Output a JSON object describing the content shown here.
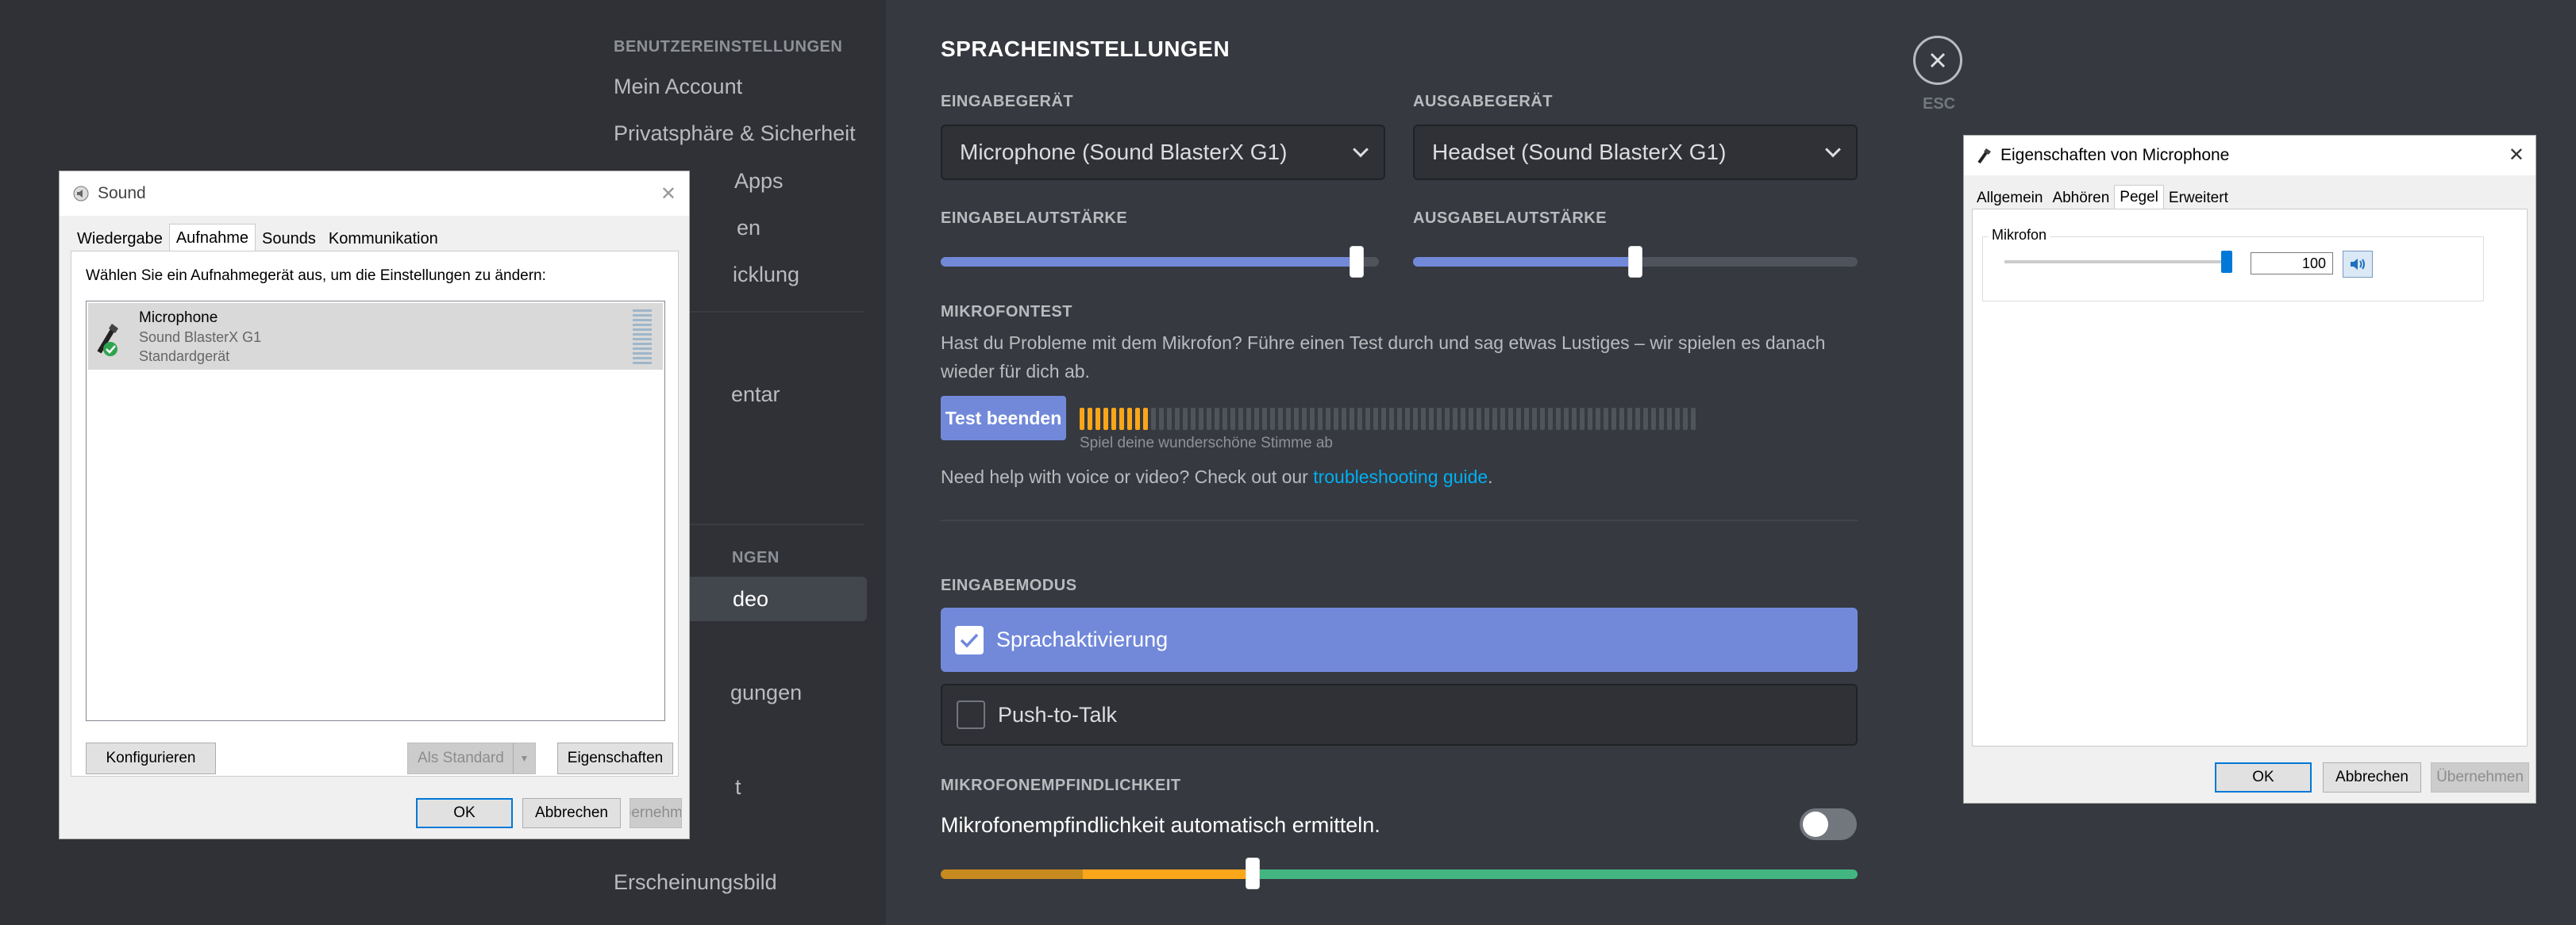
{
  "sidebar": {
    "section_user": "BENUTZEREINSTELLUNGEN",
    "items_user": [
      "Mein Account",
      "Privatsphäre & Sicherheit",
      "Apps",
      "en",
      "icklung"
    ],
    "partial_texts": [
      "entar",
      "NGEN",
      "deo",
      "gungen",
      "t",
      "Erscheinungsbild"
    ]
  },
  "main": {
    "title": "SPRACHEINSTELLUNGEN",
    "input_device_label": "EINGABEGERÄT",
    "input_device_value": "Microphone (Sound BlasterX G1)",
    "output_device_label": "AUSGABEGERÄT",
    "output_device_value": "Headset (Sound BlasterX G1)",
    "input_volume_label": "EINGABELAUTSTÄRKE",
    "input_volume_level": 0.95,
    "output_volume_label": "AUSGABELAUTSTÄRKE",
    "output_volume_level": 0.5,
    "mic_test_label": "MIKROFONTEST",
    "mic_test_text": "Hast du Probleme mit dem Mikrofon? Führe einen Test durch und sag etwas Lustiges – wir spielen es danach wieder für dich ab.",
    "test_button": "Test beenden",
    "meter_active_segments": 9,
    "meter_total_segments": 78,
    "meter_caption": "Spiel deine wunderschöne Stimme ab",
    "help_text": "Need help with voice or video? Check out our ",
    "help_link": "troubleshooting guide",
    "help_period": ".",
    "input_mode_label": "EINGABEMODUS",
    "mode_voice": "Sprachaktivierung",
    "mode_ptt": "Push-to-Talk",
    "sensitivity_label": "MIKROFONEMPFINDLICHKEIT",
    "sensitivity_auto": "Mikrofonempfindlichkeit automatisch ermitteln.",
    "sensitivity_auto_on": false,
    "sensitivity_level": 0.34,
    "esc_label": "ESC"
  },
  "sound_dialog": {
    "title": "Sound",
    "tabs": [
      "Wiedergabe",
      "Aufnahme",
      "Sounds",
      "Kommunikation"
    ],
    "active_tab": "Aufnahme",
    "instruction": "Wählen Sie ein Aufnahmegerät aus, um die Einstellungen zu ändern:",
    "device_name": "Microphone",
    "device_sub": "Sound BlasterX G1",
    "device_status": "Standardgerät",
    "btn_configure": "Konfigurieren",
    "btn_default": "Als Standard",
    "btn_properties": "Eigenschaften",
    "btn_ok": "OK",
    "btn_cancel": "Abbrechen",
    "btn_apply": "Übernehmen"
  },
  "props_dialog": {
    "title": "Eigenschaften von Microphone",
    "tabs": [
      "Allgemein",
      "Abhören",
      "Pegel",
      "Erweitert"
    ],
    "active_tab": "Pegel",
    "group_label": "Mikrofon",
    "level_value": "100",
    "level": 1.0,
    "btn_ok": "OK",
    "btn_cancel": "Abbrechen",
    "btn_apply": "Übernehmen"
  },
  "colors": {
    "blurple": "#7289da",
    "bg_main": "#36393f",
    "bg_sidebar": "#2f3136",
    "meter_on": "#faa61a",
    "sens_low": "#c78a1e",
    "sens_mid": "#faa61a",
    "sens_high": "#43b581",
    "link": "#00b0f4"
  }
}
